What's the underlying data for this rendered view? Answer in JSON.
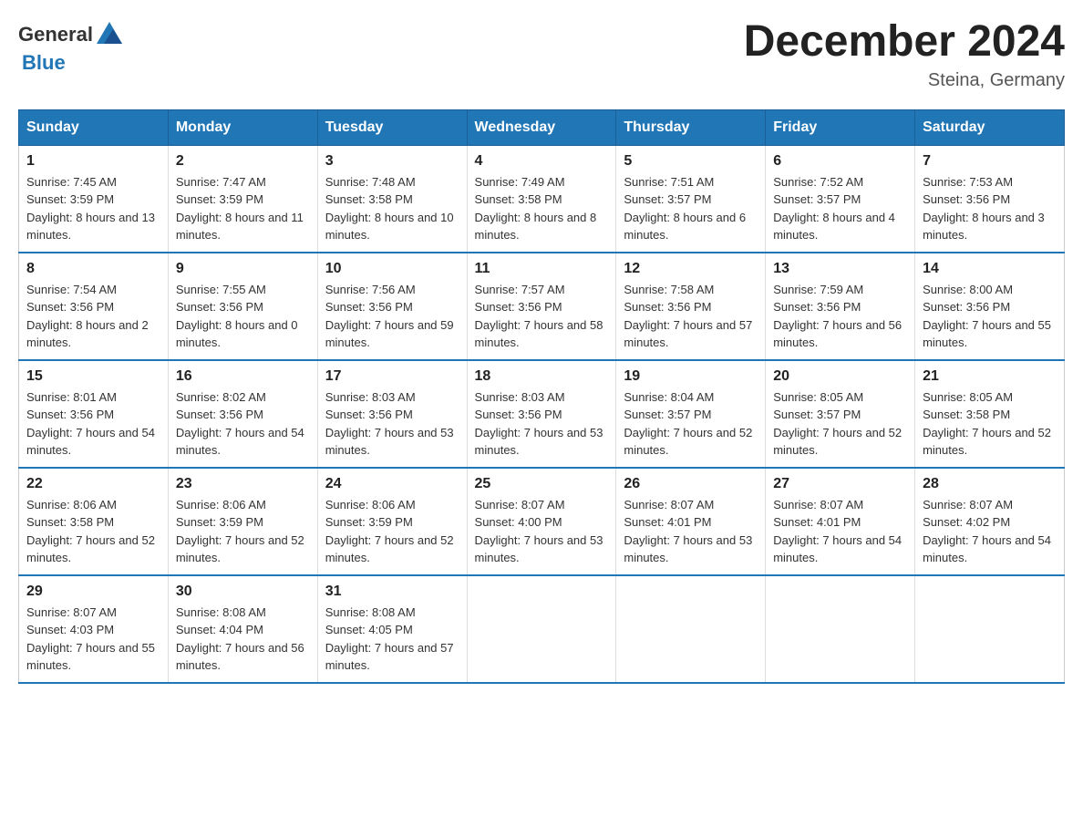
{
  "header": {
    "logo_text_general": "General",
    "logo_text_blue": "Blue",
    "month_title": "December 2024",
    "location": "Steina, Germany"
  },
  "days_of_week": [
    "Sunday",
    "Monday",
    "Tuesday",
    "Wednesday",
    "Thursday",
    "Friday",
    "Saturday"
  ],
  "weeks": [
    [
      {
        "num": "1",
        "sunrise": "7:45 AM",
        "sunset": "3:59 PM",
        "daylight": "8 hours and 13 minutes."
      },
      {
        "num": "2",
        "sunrise": "7:47 AM",
        "sunset": "3:59 PM",
        "daylight": "8 hours and 11 minutes."
      },
      {
        "num": "3",
        "sunrise": "7:48 AM",
        "sunset": "3:58 PM",
        "daylight": "8 hours and 10 minutes."
      },
      {
        "num": "4",
        "sunrise": "7:49 AM",
        "sunset": "3:58 PM",
        "daylight": "8 hours and 8 minutes."
      },
      {
        "num": "5",
        "sunrise": "7:51 AM",
        "sunset": "3:57 PM",
        "daylight": "8 hours and 6 minutes."
      },
      {
        "num": "6",
        "sunrise": "7:52 AM",
        "sunset": "3:57 PM",
        "daylight": "8 hours and 4 minutes."
      },
      {
        "num": "7",
        "sunrise": "7:53 AM",
        "sunset": "3:56 PM",
        "daylight": "8 hours and 3 minutes."
      }
    ],
    [
      {
        "num": "8",
        "sunrise": "7:54 AM",
        "sunset": "3:56 PM",
        "daylight": "8 hours and 2 minutes."
      },
      {
        "num": "9",
        "sunrise": "7:55 AM",
        "sunset": "3:56 PM",
        "daylight": "8 hours and 0 minutes."
      },
      {
        "num": "10",
        "sunrise": "7:56 AM",
        "sunset": "3:56 PM",
        "daylight": "7 hours and 59 minutes."
      },
      {
        "num": "11",
        "sunrise": "7:57 AM",
        "sunset": "3:56 PM",
        "daylight": "7 hours and 58 minutes."
      },
      {
        "num": "12",
        "sunrise": "7:58 AM",
        "sunset": "3:56 PM",
        "daylight": "7 hours and 57 minutes."
      },
      {
        "num": "13",
        "sunrise": "7:59 AM",
        "sunset": "3:56 PM",
        "daylight": "7 hours and 56 minutes."
      },
      {
        "num": "14",
        "sunrise": "8:00 AM",
        "sunset": "3:56 PM",
        "daylight": "7 hours and 55 minutes."
      }
    ],
    [
      {
        "num": "15",
        "sunrise": "8:01 AM",
        "sunset": "3:56 PM",
        "daylight": "7 hours and 54 minutes."
      },
      {
        "num": "16",
        "sunrise": "8:02 AM",
        "sunset": "3:56 PM",
        "daylight": "7 hours and 54 minutes."
      },
      {
        "num": "17",
        "sunrise": "8:03 AM",
        "sunset": "3:56 PM",
        "daylight": "7 hours and 53 minutes."
      },
      {
        "num": "18",
        "sunrise": "8:03 AM",
        "sunset": "3:56 PM",
        "daylight": "7 hours and 53 minutes."
      },
      {
        "num": "19",
        "sunrise": "8:04 AM",
        "sunset": "3:57 PM",
        "daylight": "7 hours and 52 minutes."
      },
      {
        "num": "20",
        "sunrise": "8:05 AM",
        "sunset": "3:57 PM",
        "daylight": "7 hours and 52 minutes."
      },
      {
        "num": "21",
        "sunrise": "8:05 AM",
        "sunset": "3:58 PM",
        "daylight": "7 hours and 52 minutes."
      }
    ],
    [
      {
        "num": "22",
        "sunrise": "8:06 AM",
        "sunset": "3:58 PM",
        "daylight": "7 hours and 52 minutes."
      },
      {
        "num": "23",
        "sunrise": "8:06 AM",
        "sunset": "3:59 PM",
        "daylight": "7 hours and 52 minutes."
      },
      {
        "num": "24",
        "sunrise": "8:06 AM",
        "sunset": "3:59 PM",
        "daylight": "7 hours and 52 minutes."
      },
      {
        "num": "25",
        "sunrise": "8:07 AM",
        "sunset": "4:00 PM",
        "daylight": "7 hours and 53 minutes."
      },
      {
        "num": "26",
        "sunrise": "8:07 AM",
        "sunset": "4:01 PM",
        "daylight": "7 hours and 53 minutes."
      },
      {
        "num": "27",
        "sunrise": "8:07 AM",
        "sunset": "4:01 PM",
        "daylight": "7 hours and 54 minutes."
      },
      {
        "num": "28",
        "sunrise": "8:07 AM",
        "sunset": "4:02 PM",
        "daylight": "7 hours and 54 minutes."
      }
    ],
    [
      {
        "num": "29",
        "sunrise": "8:07 AM",
        "sunset": "4:03 PM",
        "daylight": "7 hours and 55 minutes."
      },
      {
        "num": "30",
        "sunrise": "8:08 AM",
        "sunset": "4:04 PM",
        "daylight": "7 hours and 56 minutes."
      },
      {
        "num": "31",
        "sunrise": "8:08 AM",
        "sunset": "4:05 PM",
        "daylight": "7 hours and 57 minutes."
      },
      null,
      null,
      null,
      null
    ]
  ]
}
